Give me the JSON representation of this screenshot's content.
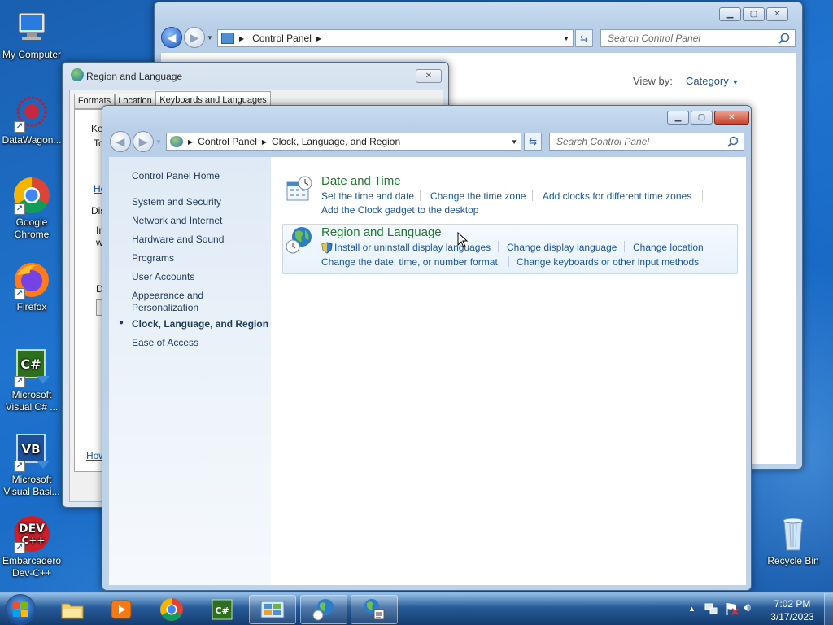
{
  "desktop": {
    "icons": [
      {
        "label": "My Computer"
      },
      {
        "label": "DataWagon..."
      },
      {
        "label": "Google Chrome"
      },
      {
        "label": "Firefox"
      },
      {
        "label": "Microsoft Visual C# ..."
      },
      {
        "label": "Microsoft Visual Basi..."
      },
      {
        "label": "Embarcadero Dev-C++"
      },
      {
        "label": "Recycle Bin"
      }
    ]
  },
  "back_window": {
    "address": {
      "root": "Control Panel"
    },
    "search_placeholder": "Search Control Panel",
    "view_by_label": "View by:",
    "view_by_value": "Category"
  },
  "region_dialog": {
    "title": "Region and Language",
    "tabs": [
      "Formats",
      "Location",
      "Keyboards and Languages"
    ],
    "partial_texts": [
      "Ke",
      "To",
      "He",
      "Dis",
      "In",
      "w",
      "D",
      "How"
    ]
  },
  "front_window": {
    "address": {
      "root": "Control Panel",
      "current": "Clock, Language, and Region"
    },
    "search_placeholder": "Search Control Panel",
    "sidebar": {
      "home": "Control Panel Home",
      "items": [
        "System and Security",
        "Network and Internet",
        "Hardware and Sound",
        "Programs",
        "User Accounts",
        "Appearance and Personalization",
        "Clock, Language, and Region",
        "Ease of Access"
      ],
      "active_index": 6
    },
    "sections": {
      "date_time": {
        "title": "Date and Time",
        "links": [
          "Set the time and date",
          "Change the time zone",
          "Add clocks for different time zones",
          "Add the Clock gadget to the desktop"
        ]
      },
      "region": {
        "title": "Region and Language",
        "links": [
          "Install or uninstall display languages",
          "Change display language",
          "Change location",
          "Change the date, time, or number format",
          "Change keyboards or other input methods"
        ]
      }
    }
  },
  "taskbar": {
    "time": "7:02 PM",
    "date": "3/17/2023",
    "accent": "#1f74cf"
  }
}
